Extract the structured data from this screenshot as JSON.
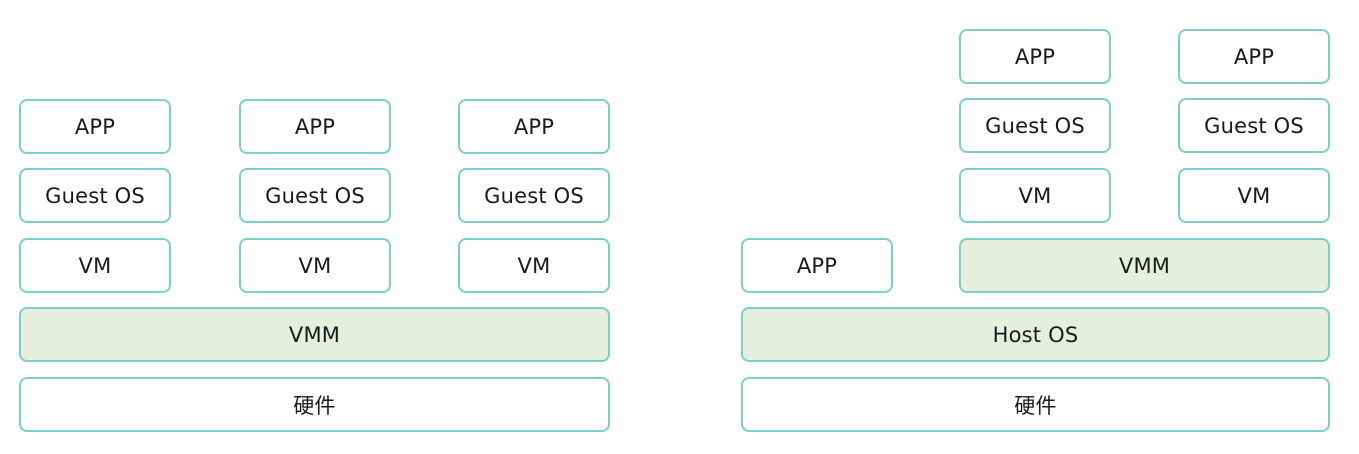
{
  "left_stack": {
    "columns": [
      {
        "app": "APP",
        "guest_os": "Guest OS",
        "vm": "VM"
      },
      {
        "app": "APP",
        "guest_os": "Guest OS",
        "vm": "VM"
      },
      {
        "app": "APP",
        "guest_os": "Guest OS",
        "vm": "VM"
      }
    ],
    "vmm": "VMM",
    "hardware": "硬件"
  },
  "right_stack": {
    "native_app": "APP",
    "columns": [
      {
        "app": "APP",
        "guest_os": "Guest OS",
        "vm": "VM"
      },
      {
        "app": "APP",
        "guest_os": "Guest OS",
        "vm": "VM"
      }
    ],
    "vmm": "VMM",
    "host_os": "Host OS",
    "hardware": "硬件"
  },
  "colors": {
    "border": "#7ccfc9",
    "shaded_fill": "#e6efdd",
    "plain_fill": "#ffffff"
  }
}
